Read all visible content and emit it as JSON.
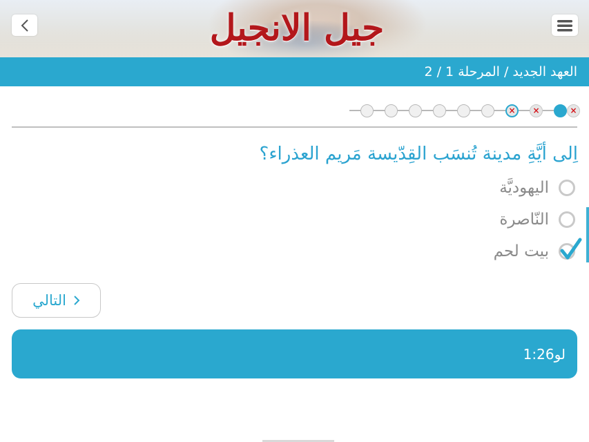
{
  "header": {
    "title": "جيل الانجيل",
    "back_icon": "chevron-left-icon",
    "menu_icon": "hamburger-menu-icon",
    "title_color": "#b3171b"
  },
  "stage_bar": {
    "text": "العهد الجديد / المرحلة 1 / 2",
    "color": "#2aa8cf"
  },
  "progress": {
    "total": 10,
    "dots": [
      {
        "state": "wrong",
        "mark": "×"
      },
      {
        "state": "current",
        "mark": ""
      },
      {
        "state": "wrong",
        "mark": "×"
      },
      {
        "state": "wrong-ringed",
        "mark": "×"
      },
      {
        "state": "pending",
        "mark": ""
      },
      {
        "state": "pending",
        "mark": ""
      },
      {
        "state": "pending",
        "mark": ""
      },
      {
        "state": "pending",
        "mark": ""
      },
      {
        "state": "pending",
        "mark": ""
      },
      {
        "state": "pending",
        "mark": ""
      }
    ]
  },
  "question": {
    "text": "اِلى أيَّةِ مدينة تُنسَب القِدّيسة مَريم العذراء؟"
  },
  "options": [
    {
      "label": "اليهوديَّة",
      "selected": false
    },
    {
      "label": "النّاصرة",
      "selected": false
    },
    {
      "label": "بيت لحم",
      "selected": true
    }
  ],
  "next_button": {
    "label": "التالي",
    "icon": "chevron-right-icon"
  },
  "reference": {
    "text": "لو1:26"
  },
  "colors": {
    "accent": "#2aa8cf",
    "wrong": "#d4161c",
    "option_text": "#8a8a8a"
  }
}
